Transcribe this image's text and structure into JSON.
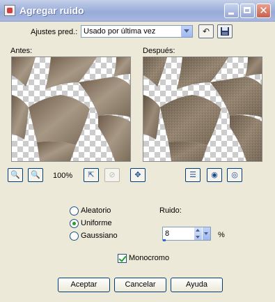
{
  "window": {
    "title": "Agregar ruido"
  },
  "presets": {
    "label": "Ajustes pred.:",
    "value": "Usado por última vez"
  },
  "preview": {
    "before_label": "Antes:",
    "after_label": "Después:",
    "zoom": "100%"
  },
  "noise_type": {
    "options": [
      {
        "label": "Aleatorio",
        "selected": false
      },
      {
        "label": "Uniforme",
        "selected": true
      },
      {
        "label": "Gaussiano",
        "selected": false
      }
    ]
  },
  "noise": {
    "label": "Ruido:",
    "value": "8",
    "unit": "%"
  },
  "monochrome": {
    "label": "Monocromo",
    "checked": true
  },
  "buttons": {
    "accept": "Aceptar",
    "cancel": "Cancelar",
    "help": "Ayuda"
  },
  "icons": {
    "title_min": "minimize-icon",
    "title_max": "maximize-icon",
    "title_close": "close-icon",
    "reset": "reset-arrow-icon",
    "save": "floppy-save-icon",
    "zoom_out": "zoom-out-icon",
    "zoom_in": "zoom-in-icon",
    "fit": "fit-window-icon",
    "zoom_locked": "zoom-lock-icon",
    "pan": "pan-move-icon",
    "toggle_preview": "preview-window-icon",
    "lock_view": "eye-lock-icon",
    "auto_proof": "eye-icon"
  },
  "colors": {
    "title_bar": "#a5b6de",
    "surface": "#ece9d8",
    "accent_check": "#21a121"
  }
}
